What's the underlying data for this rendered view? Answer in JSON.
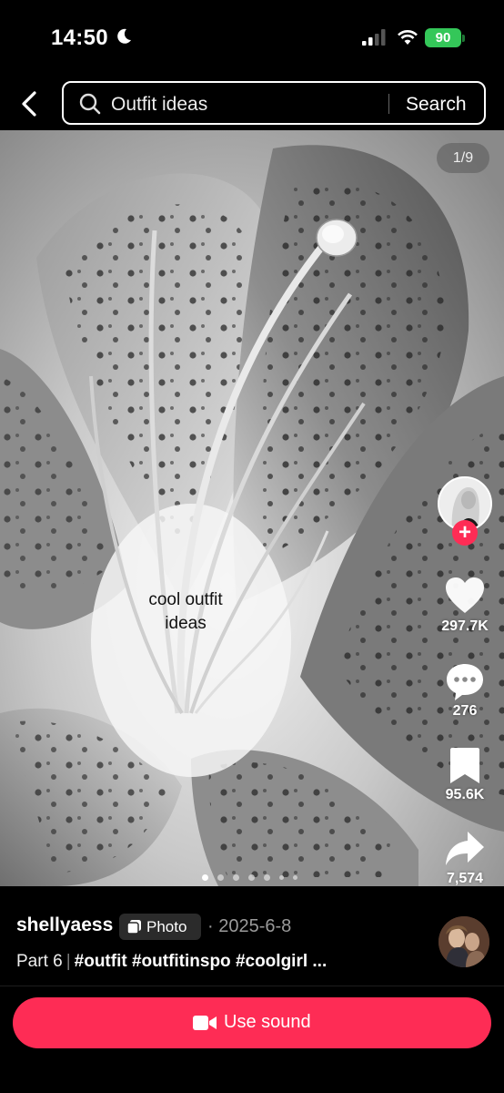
{
  "status_bar": {
    "time": "14:50",
    "battery": "90"
  },
  "search": {
    "query": "Outfit ideas",
    "button_label": "Search"
  },
  "post": {
    "counter": "1/9",
    "overlay_text_line1": "cool outfit",
    "overlay_text_line2": "ideas",
    "total_slides": 9,
    "current_slide": 1
  },
  "rail": {
    "likes": "297.7K",
    "comments": "276",
    "saves": "95.6K",
    "shares": "7,574"
  },
  "info": {
    "username": "shellyaess",
    "badge_label": "Photo",
    "date": "· 2025-6-8",
    "desc_plain": "Part 6",
    "desc_tags": "#outfit #outfitinspo #coolgirl ..."
  },
  "actions": {
    "use_sound_label": "Use sound"
  },
  "colors": {
    "accent": "#fe2c55",
    "battery": "#34c759",
    "background": "#000000"
  },
  "icons": [
    "moon-icon",
    "signal-icon",
    "wifi-icon",
    "back-icon",
    "search-icon",
    "heart-icon",
    "comment-icon",
    "bookmark-icon",
    "share-icon",
    "photo-icon",
    "video-camera-icon"
  ]
}
